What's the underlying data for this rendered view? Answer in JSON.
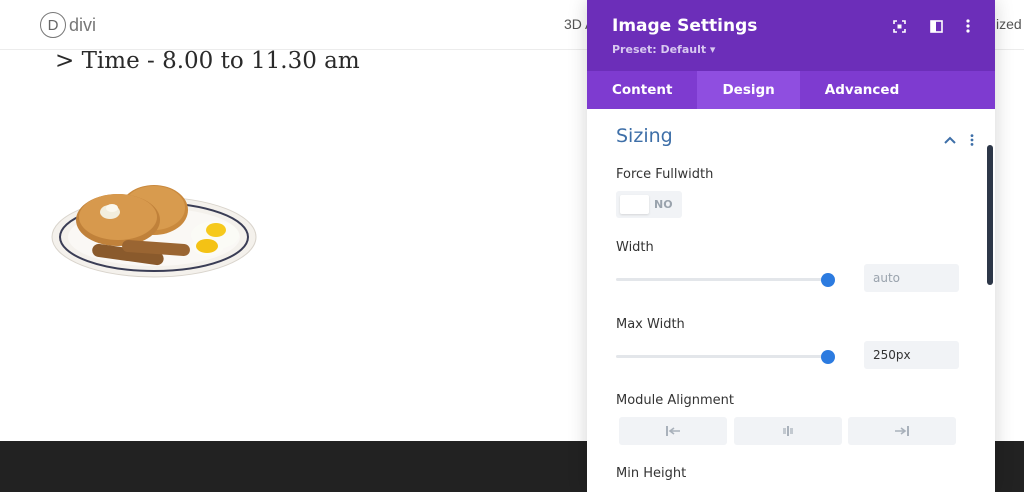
{
  "site": {
    "logo_letter": "D",
    "logo_text": "divi",
    "nav_left_text": "3D A",
    "nav_right_text": "ized"
  },
  "content": {
    "time_text": "> Time - 8.00 to 11.30 am"
  },
  "modal": {
    "title": "Image Settings",
    "preset": "Preset: Default ▾",
    "tabs": [
      {
        "label": "Content",
        "active": false
      },
      {
        "label": "Design",
        "active": true
      },
      {
        "label": "Advanced",
        "active": false
      }
    ],
    "section": {
      "title": "Sizing",
      "fields": {
        "force_fullwidth": {
          "label": "Force Fullwidth",
          "value": "NO"
        },
        "width": {
          "label": "Width",
          "value": "auto",
          "slider_fraction": 1.0
        },
        "max_width": {
          "label": "Max Width",
          "value": "250px",
          "slider_fraction": 1.0
        },
        "module_alignment": {
          "label": "Module Alignment",
          "options": [
            "left",
            "center",
            "right"
          ]
        },
        "min_height": {
          "label": "Min Height"
        }
      }
    }
  },
  "colors": {
    "header_purple": "#6c2eb9",
    "tab_purple": "#7e3bd0",
    "active_tab": "#8f4ee0",
    "accent_blue": "#2c7be0",
    "section_blue": "#3e6fa8",
    "footer": "#222222"
  },
  "icons": {
    "header": [
      "fullscreen-icon",
      "split-view-icon",
      "more-vertical-icon"
    ],
    "section": [
      "chevron-up-icon",
      "more-vertical-icon"
    ],
    "alignment": [
      "align-left-icon",
      "align-center-icon",
      "align-right-icon"
    ]
  }
}
